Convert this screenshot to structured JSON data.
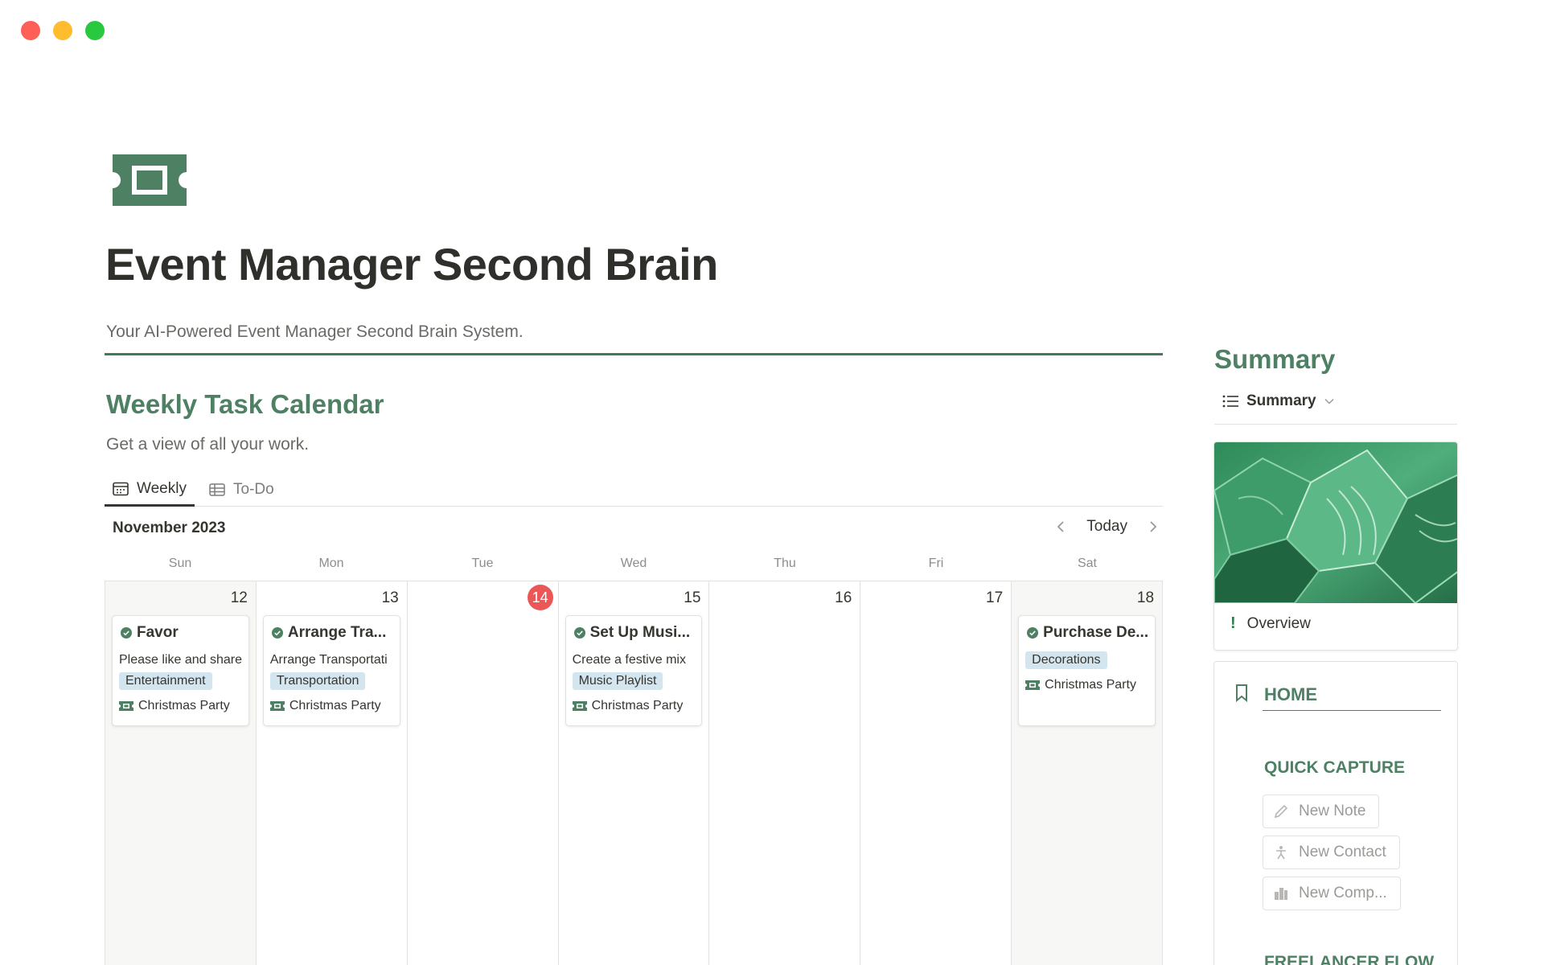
{
  "page": {
    "title": "Event Manager Second Brain",
    "description": "Your AI-Powered Event Manager Second Brain System.",
    "icon": "ticket-icon",
    "accent_color": "#4e8064"
  },
  "calendar_section": {
    "title": "Weekly Task Calendar",
    "subtitle": "Get a view of all your work.",
    "tabs": [
      {
        "label": "Weekly",
        "icon": "calendar-icon",
        "active": true
      },
      {
        "label": "To-Do",
        "icon": "table-icon",
        "active": false
      }
    ],
    "month": "November 2023",
    "today_label": "Today",
    "weekdays": [
      "Sun",
      "Mon",
      "Tue",
      "Wed",
      "Thu",
      "Fri",
      "Sat"
    ],
    "days": [
      {
        "num": "12",
        "today": false,
        "weekend": true
      },
      {
        "num": "13",
        "today": false,
        "weekend": false
      },
      {
        "num": "14",
        "today": true,
        "weekend": false
      },
      {
        "num": "15",
        "today": false,
        "weekend": false
      },
      {
        "num": "16",
        "today": false,
        "weekend": false
      },
      {
        "num": "17",
        "today": false,
        "weekend": false
      },
      {
        "num": "18",
        "today": false,
        "weekend": true
      }
    ],
    "cards": {
      "sun": {
        "title": "Favor",
        "desc": "Please like and share",
        "tag": "Entertainment",
        "relation": "Christmas Party"
      },
      "mon": {
        "title": "Arrange Tra...",
        "desc": "Arrange Transportati",
        "tag": "Transportation",
        "relation": "Christmas Party"
      },
      "wed": {
        "title": "Set Up Musi...",
        "desc": "Create a festive mix",
        "tag": "Music Playlist",
        "relation": "Christmas Party"
      },
      "sat": {
        "title": "Purchase De...",
        "tag": "Decorations",
        "relation": "Christmas Party"
      }
    },
    "tag_color": "#d3e5ef",
    "today_color": "#eb5757"
  },
  "summary": {
    "heading": "Summary",
    "view_label": "Summary",
    "overview_label": "Overview",
    "home": {
      "title": "HOME",
      "quick_capture_title": "QUICK CAPTURE",
      "buttons": [
        {
          "label": "New Note",
          "icon": "pencil-icon"
        },
        {
          "label": "New Contact",
          "icon": "person-icon"
        },
        {
          "label": "New Comp...",
          "icon": "building-icon"
        }
      ],
      "next_section_title": "FREELANCER FLOW"
    }
  }
}
